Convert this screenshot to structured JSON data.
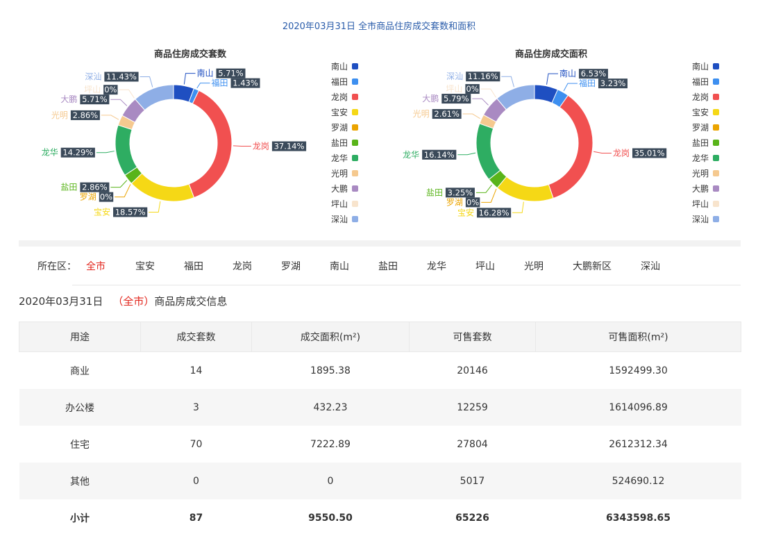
{
  "page_title": "2020年03月31日 全市商品住房成交套数和面积",
  "chart_data": [
    {
      "type": "pie",
      "donut": true,
      "title": "商品住房成交套数",
      "unit": "%",
      "slices": [
        {
          "name": "南山",
          "value": 5.71,
          "color": "#1f4fc1"
        },
        {
          "name": "福田",
          "value": 1.43,
          "color": "#3d8ff0"
        },
        {
          "name": "龙岗",
          "value": 37.14,
          "color": "#f15050"
        },
        {
          "name": "宝安",
          "value": 18.57,
          "color": "#f5d816"
        },
        {
          "name": "罗湖",
          "value": 0,
          "color": "#eba400"
        },
        {
          "name": "盐田",
          "value": 2.86,
          "color": "#59b41a"
        },
        {
          "name": "龙华",
          "value": 14.29,
          "color": "#2ead62"
        },
        {
          "name": "光明",
          "value": 2.86,
          "color": "#f5c98f"
        },
        {
          "name": "大鹏",
          "value": 5.71,
          "color": "#a98ac2"
        },
        {
          "name": "坪山",
          "value": 0,
          "color": "#f8e4cd"
        },
        {
          "name": "深汕",
          "value": 11.43,
          "color": "#8eaee6"
        }
      ],
      "labels": [
        "5.71%",
        "1.43%",
        "37.14%",
        "18.57%",
        "0%",
        "2.86%",
        "14.29%",
        "2.86%",
        "5.71%",
        "0%",
        "11.43%"
      ],
      "legend": "right"
    },
    {
      "type": "pie",
      "donut": true,
      "title": "商品住房成交面积",
      "unit": "%",
      "slices": [
        {
          "name": "南山",
          "value": 6.53,
          "color": "#1f4fc1"
        },
        {
          "name": "福田",
          "value": 3.23,
          "color": "#3d8ff0"
        },
        {
          "name": "龙岗",
          "value": 35.01,
          "color": "#f15050"
        },
        {
          "name": "宝安",
          "value": 16.28,
          "color": "#f5d816"
        },
        {
          "name": "罗湖",
          "value": 0,
          "color": "#eba400"
        },
        {
          "name": "盐田",
          "value": 3.25,
          "color": "#59b41a"
        },
        {
          "name": "龙华",
          "value": 16.14,
          "color": "#2ead62"
        },
        {
          "name": "光明",
          "value": 2.61,
          "color": "#f5c98f"
        },
        {
          "name": "大鹏",
          "value": 5.79,
          "color": "#a98ac2"
        },
        {
          "name": "坪山",
          "value": 0,
          "color": "#f8e4cd"
        },
        {
          "name": "深汕",
          "value": 11.16,
          "color": "#8eaee6"
        }
      ],
      "labels": [
        "6.53%",
        "3.23%",
        "35.01%",
        "16.28%",
        "0%",
        "3.25%",
        "16.14%",
        "2.61%",
        "5.79%",
        "0%",
        "11.16%"
      ],
      "legend": "right"
    }
  ],
  "filter": {
    "label": "所在区：",
    "items": [
      "全市",
      "宝安",
      "福田",
      "龙岗",
      "罗湖",
      "南山",
      "盐田",
      "龙华",
      "坪山",
      "光明",
      "大鹏新区",
      "深汕"
    ],
    "active": "全市"
  },
  "info": {
    "date": "2020年03月31日",
    "open": "（",
    "area": "全市",
    "close": "）",
    "suffix": "商品房成交信息"
  },
  "table": {
    "headers": [
      "用途",
      "成交套数",
      "成交面积(m²)",
      "可售套数",
      "可售面积(m²)"
    ],
    "rows": [
      [
        "商业",
        "14",
        "1895.38",
        "20146",
        "1592499.30"
      ],
      [
        "办公楼",
        "3",
        "432.23",
        "12259",
        "1614096.89"
      ],
      [
        "住宅",
        "70",
        "7222.89",
        "27804",
        "2612312.34"
      ],
      [
        "其他",
        "0",
        "0",
        "5017",
        "524690.12"
      ]
    ],
    "total": [
      "小计",
      "87",
      "9550.50",
      "65226",
      "6343598.65"
    ]
  }
}
